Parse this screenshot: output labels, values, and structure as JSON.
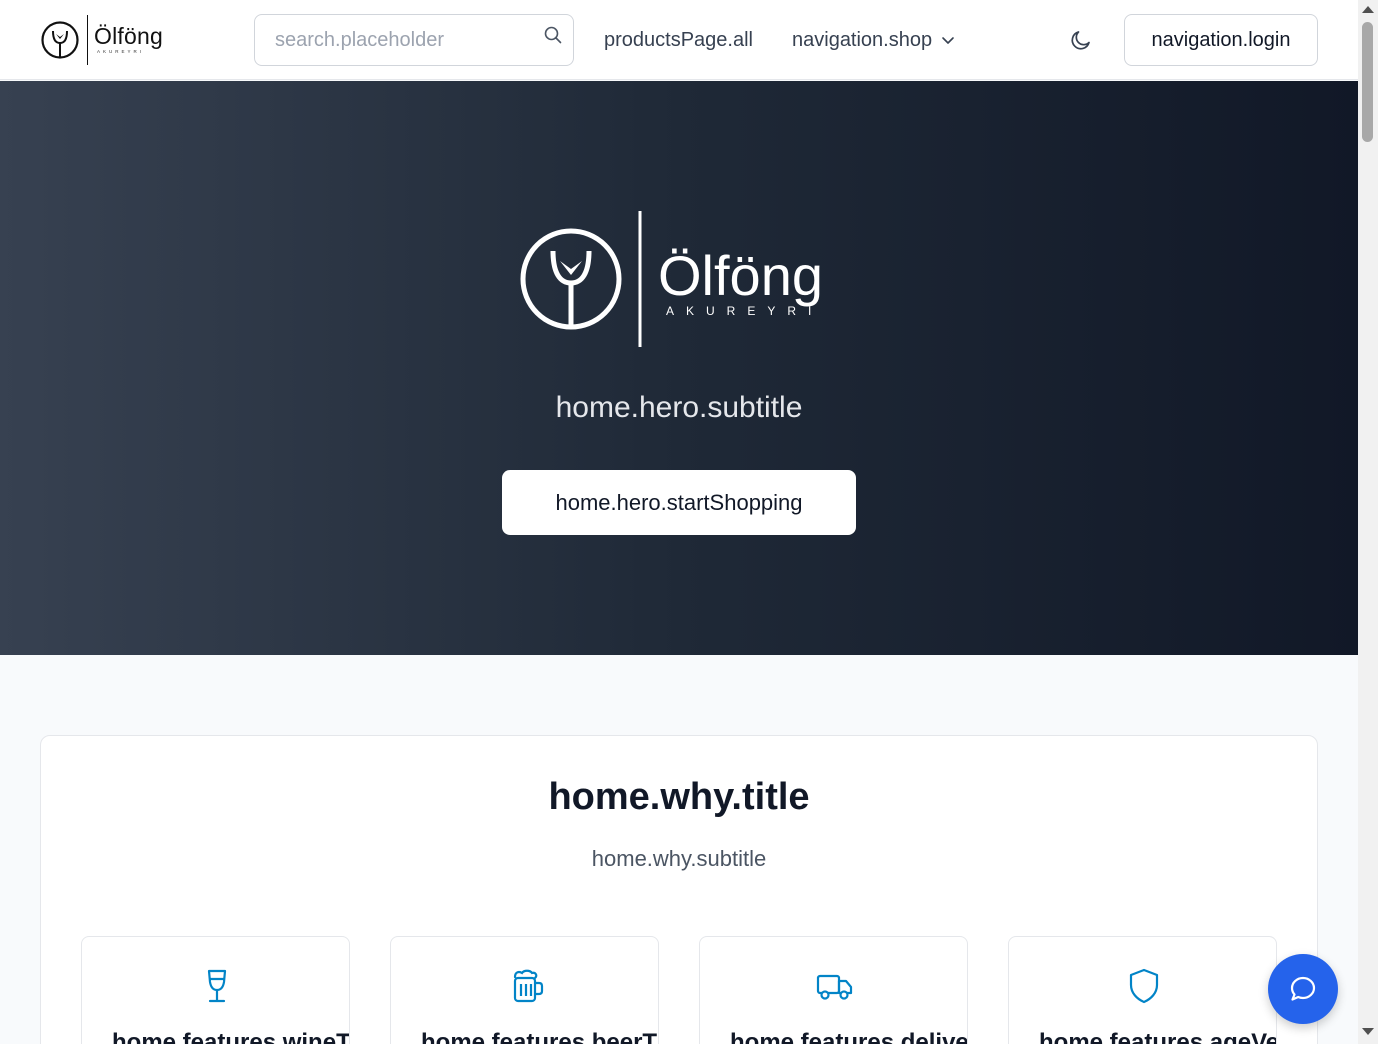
{
  "header": {
    "brand_name": "Ölföng",
    "brand_sub": "AKUREYRI",
    "search_placeholder": "search.placeholder",
    "nav_all": "productsPage.all",
    "nav_shop": "navigation.shop",
    "login_label": "navigation.login"
  },
  "hero": {
    "brand_name": "Ölföng",
    "brand_sub": "AKUREYRI",
    "subtitle": "home.hero.subtitle",
    "cta_label": "home.hero.startShopping"
  },
  "why": {
    "title": "home.why.title",
    "subtitle": "home.why.subtitle",
    "features": [
      {
        "title": "home.features.wineTitle",
        "icon": "wine-glass-icon"
      },
      {
        "title": "home.features.beerTitle",
        "icon": "beer-mug-icon"
      },
      {
        "title": "home.features.deliveryTitle",
        "icon": "truck-icon"
      },
      {
        "title": "home.features.ageVerificationTitle",
        "icon": "shield-icon"
      }
    ]
  },
  "icons": {
    "search": "search-icon",
    "theme": "moon-icon",
    "chat": "chat-bubble-icon",
    "dropdown": "chevron-down-icon"
  },
  "colors": {
    "accent": "#2563eb",
    "feature_icon": "#0284c7",
    "hero_start": "#374151",
    "hero_end": "#111827"
  }
}
